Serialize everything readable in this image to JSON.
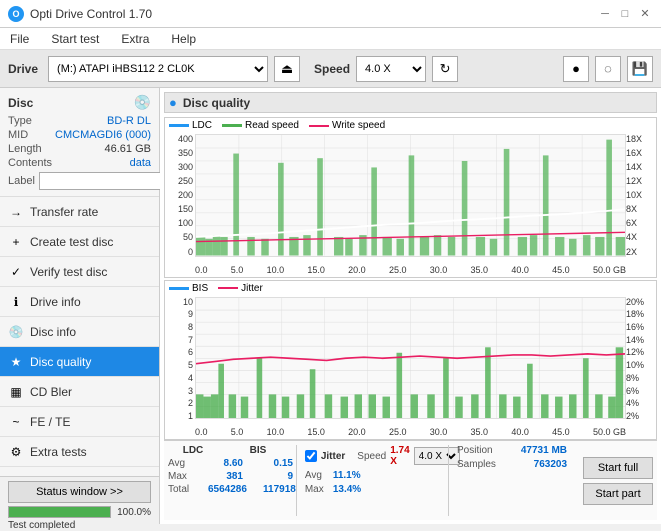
{
  "app": {
    "title": "Opti Drive Control 1.70",
    "logo": "O"
  },
  "titlebar": {
    "title": "Opti Drive Control 1.70",
    "minimize": "─",
    "maximize": "□",
    "close": "✕"
  },
  "menubar": {
    "items": [
      "File",
      "Start test",
      "Extra",
      "Help"
    ]
  },
  "toolbar": {
    "drive_label": "Drive",
    "drive_value": "(M:)  ATAPI iHBS112  2 CL0K",
    "speed_label": "Speed",
    "speed_value": "4.0 X",
    "eject_icon": "⏏",
    "burn_icon": "●",
    "erase_icon": "◌",
    "save_icon": "💾"
  },
  "disc": {
    "section_title": "Disc",
    "type_label": "Type",
    "type_value": "BD-R DL",
    "mid_label": "MID",
    "mid_value": "CMCMAGDI6 (000)",
    "length_label": "Length",
    "length_value": "46.61 GB",
    "contents_label": "Contents",
    "contents_value": "data",
    "label_label": "Label",
    "label_placeholder": ""
  },
  "sidebar_nav": [
    {
      "id": "transfer-rate",
      "label": "Transfer rate",
      "icon": "→"
    },
    {
      "id": "create-test-disc",
      "label": "Create test disc",
      "icon": "+"
    },
    {
      "id": "verify-test-disc",
      "label": "Verify test disc",
      "icon": "✓"
    },
    {
      "id": "drive-info",
      "label": "Drive info",
      "icon": "ℹ"
    },
    {
      "id": "disc-info",
      "label": "Disc info",
      "icon": "💿"
    },
    {
      "id": "disc-quality",
      "label": "Disc quality",
      "icon": "★",
      "active": true
    },
    {
      "id": "cd-bler",
      "label": "CD Bler",
      "icon": "▦"
    },
    {
      "id": "fe-te",
      "label": "FE / TE",
      "icon": "~"
    },
    {
      "id": "extra-tests",
      "label": "Extra tests",
      "icon": "⚙"
    }
  ],
  "status": {
    "window_btn": "Status window >>",
    "progress_pct": "100.0%",
    "completed_text": "Test completed"
  },
  "dq": {
    "title": "Disc quality",
    "chart1": {
      "title": "LDC / Read / Write",
      "legend": [
        {
          "id": "ldc",
          "label": "LDC",
          "color": "#2196F3"
        },
        {
          "id": "read",
          "label": "Read speed",
          "color": "#4CAF50"
        },
        {
          "id": "write",
          "label": "Write speed",
          "color": "#E91E63"
        }
      ],
      "y_left": [
        "400",
        "350",
        "300",
        "250",
        "200",
        "150",
        "100",
        "50",
        "0"
      ],
      "y_right": [
        "18X",
        "16X",
        "14X",
        "12X",
        "10X",
        "8X",
        "6X",
        "4X",
        "2X"
      ],
      "x_labels": [
        "0.0",
        "5.0",
        "10.0",
        "15.0",
        "20.0",
        "25.0",
        "30.0",
        "35.0",
        "40.0",
        "45.0",
        "50.0 GB"
      ]
    },
    "chart2": {
      "title": "BIS / Jitter",
      "legend": [
        {
          "id": "bis",
          "label": "BIS",
          "color": "#2196F3"
        },
        {
          "id": "jitter",
          "label": "Jitter",
          "color": "#E91E63"
        }
      ],
      "y_left": [
        "10",
        "9",
        "8",
        "7",
        "6",
        "5",
        "4",
        "3",
        "2",
        "1"
      ],
      "y_right": [
        "20%",
        "18%",
        "16%",
        "14%",
        "12%",
        "10%",
        "8%",
        "6%",
        "4%",
        "2%"
      ],
      "x_labels": [
        "0.0",
        "5.0",
        "10.0",
        "15.0",
        "20.0",
        "25.0",
        "30.0",
        "35.0",
        "40.0",
        "45.0",
        "50.0 GB"
      ]
    }
  },
  "stats": {
    "ldc_label": "LDC",
    "bis_label": "BIS",
    "jitter_label": "Jitter",
    "speed_label": "Speed",
    "avg_label": "Avg",
    "max_label": "Max",
    "total_label": "Total",
    "ldc_avg": "8.60",
    "ldc_max": "381",
    "ldc_total": "6564286",
    "bis_avg": "0.15",
    "bis_max": "9",
    "bis_total": "117918",
    "jitter_avg": "11.1%",
    "jitter_max": "13.4%",
    "jitter_total": "",
    "speed_val": "1.74 X",
    "speed_sel": "4.0 X",
    "position_label": "Position",
    "samples_label": "Samples",
    "position_val": "47731 MB",
    "samples_val": "763203",
    "jitter_checked": true,
    "btn_full": "Start full",
    "btn_part": "Start part"
  }
}
